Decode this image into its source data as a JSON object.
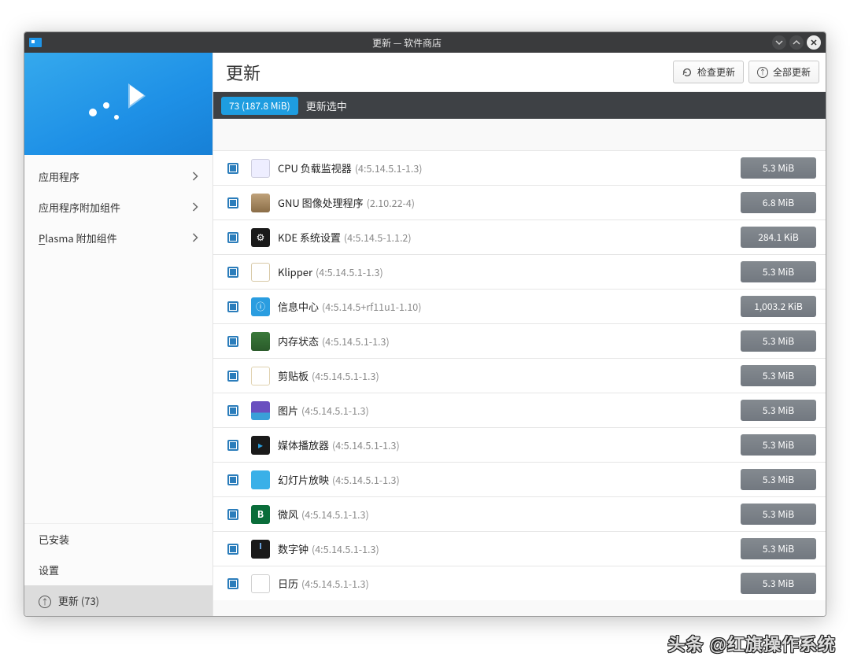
{
  "window": {
    "title": "更新 — 软件商店"
  },
  "sidebar": {
    "nav": [
      {
        "label": "应用程序"
      },
      {
        "label": "应用程序附加组件"
      },
      {
        "label": "Plasma 附加组件",
        "underline_first": true
      }
    ],
    "bottom": {
      "installed": "已安装",
      "settings": "设置",
      "updates_label": "更新",
      "updates_count": "(73)"
    }
  },
  "toolbar": {
    "title": "更新",
    "check_label": "检查更新",
    "update_all_label": "全部更新"
  },
  "selection_bar": {
    "badge": "73 (187.8 MiB)",
    "text": "更新选中"
  },
  "updates": [
    {
      "name": "CPU 负载监视器",
      "version": "(4:5.14.5.1-1.3)",
      "size": "5.3 MiB",
      "icon": "ic-cpu"
    },
    {
      "name": "GNU 图像处理程序",
      "version": "(2.10.22-4)",
      "size": "6.8 MiB",
      "icon": "ic-gimp"
    },
    {
      "name": "KDE 系统设置",
      "version": "(4:5.14.5-1.1.2)",
      "size": "284.1 KiB",
      "icon": "ic-kde"
    },
    {
      "name": "Klipper",
      "version": "(4:5.14.5.1-1.3)",
      "size": "5.3 MiB",
      "icon": "ic-klip"
    },
    {
      "name": "信息中心",
      "version": "(4:5.14.5+rf11u1-1.10)",
      "size": "1,003.2 KiB",
      "icon": "ic-info"
    },
    {
      "name": "内存状态",
      "version": "(4:5.14.5.1-1.3)",
      "size": "5.3 MiB",
      "icon": "ic-mem"
    },
    {
      "name": "剪贴板",
      "version": "(4:5.14.5.1-1.3)",
      "size": "5.3 MiB",
      "icon": "ic-clip"
    },
    {
      "name": "图片",
      "version": "(4:5.14.5.1-1.3)",
      "size": "5.3 MiB",
      "icon": "ic-img"
    },
    {
      "name": "媒体播放器",
      "version": "(4:5.14.5.1-1.3)",
      "size": "5.3 MiB",
      "icon": "ic-media"
    },
    {
      "name": "幻灯片放映",
      "version": "(4:5.14.5.1-1.3)",
      "size": "5.3 MiB",
      "icon": "ic-slides"
    },
    {
      "name": "微风",
      "version": "(4:5.14.5.1-1.3)",
      "size": "5.3 MiB",
      "icon": "ic-micro"
    },
    {
      "name": "数字钟",
      "version": "(4:5.14.5.1-1.3)",
      "size": "5.3 MiB",
      "icon": "ic-clock"
    },
    {
      "name": "日历",
      "version": "(4:5.14.5.1-1.3)",
      "size": "5.3 MiB",
      "icon": "ic-cal"
    }
  ],
  "watermark": "头条 @红旗操作系统"
}
